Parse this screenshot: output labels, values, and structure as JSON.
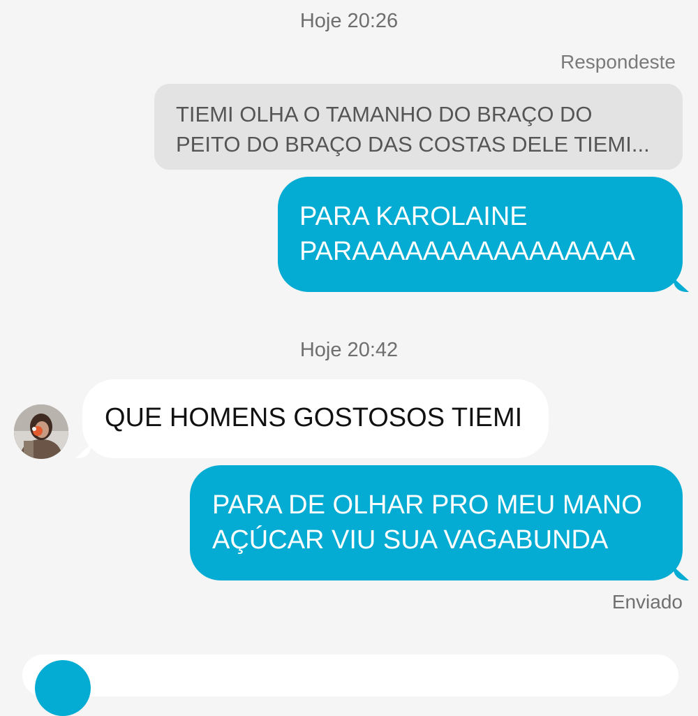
{
  "conversation": {
    "timestamp_1": "Hoje 20:26",
    "reply_label": "Respondeste",
    "quoted_message": "TIEMI OLHA O TAMANHO DO BRAÇO DO PEITO DO BRAÇO DAS COSTAS DELE TIEMI...",
    "message_1": {
      "line_1": "PARA KAROLAINE",
      "line_2": "PARAAAAAAAAAAAAAAAA"
    },
    "timestamp_2": "Hoje 20:42",
    "message_2": "QUE HOMENS GOSTOSOS TIEMI",
    "message_3": {
      "line_1": "PARA DE OLHAR PRO MEU MANO",
      "line_2": "AÇÚCAR VIU SUA VAGABUNDA"
    },
    "status_label": "Enviado"
  },
  "colors": {
    "outgoing_bubble": "#04acd3",
    "incoming_bubble": "#ffffff",
    "quoted_bubble": "#e3e3e3",
    "background": "#f5f5f5"
  },
  "icons": {
    "avatar": "user-avatar-photo",
    "composer_action": "camera-icon"
  }
}
